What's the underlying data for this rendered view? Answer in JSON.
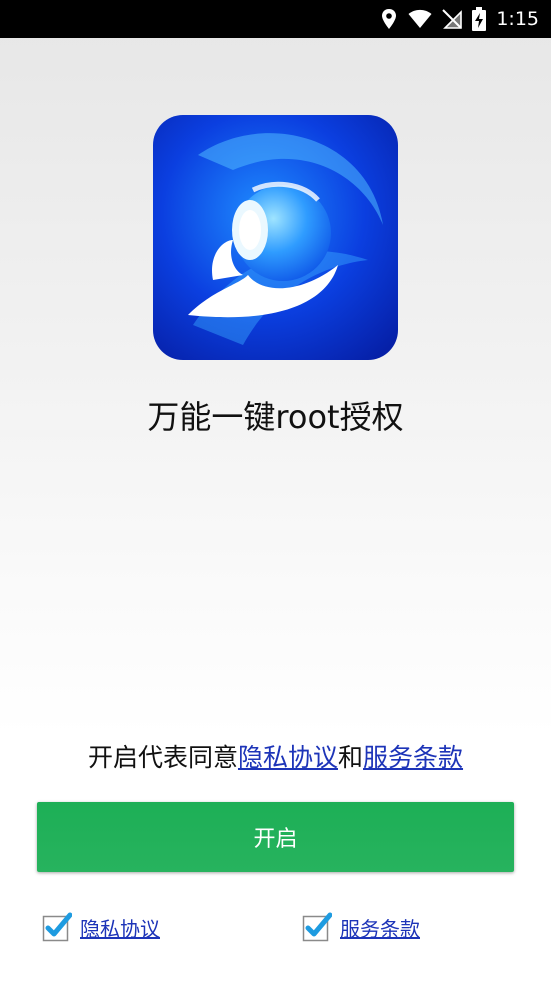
{
  "status_bar": {
    "time": "1:15",
    "icons": [
      "location-icon",
      "wifi-icon",
      "no-sim-icon",
      "battery-charging-icon"
    ]
  },
  "app": {
    "icon": "app-logo-icon",
    "name": "万能一键root授权"
  },
  "agreement": {
    "prefix": "开启代表同意",
    "privacy_link": "隐私协议",
    "and": "和",
    "terms_link": "服务条款"
  },
  "start_button": {
    "label": "开启"
  },
  "checkboxes": [
    {
      "label": "隐私协议",
      "checked": true
    },
    {
      "label": "服务条款",
      "checked": true
    }
  ],
  "colors": {
    "accent_green": "#1daf56",
    "link_blue": "#1d34b8",
    "status_bar": "#000000"
  }
}
